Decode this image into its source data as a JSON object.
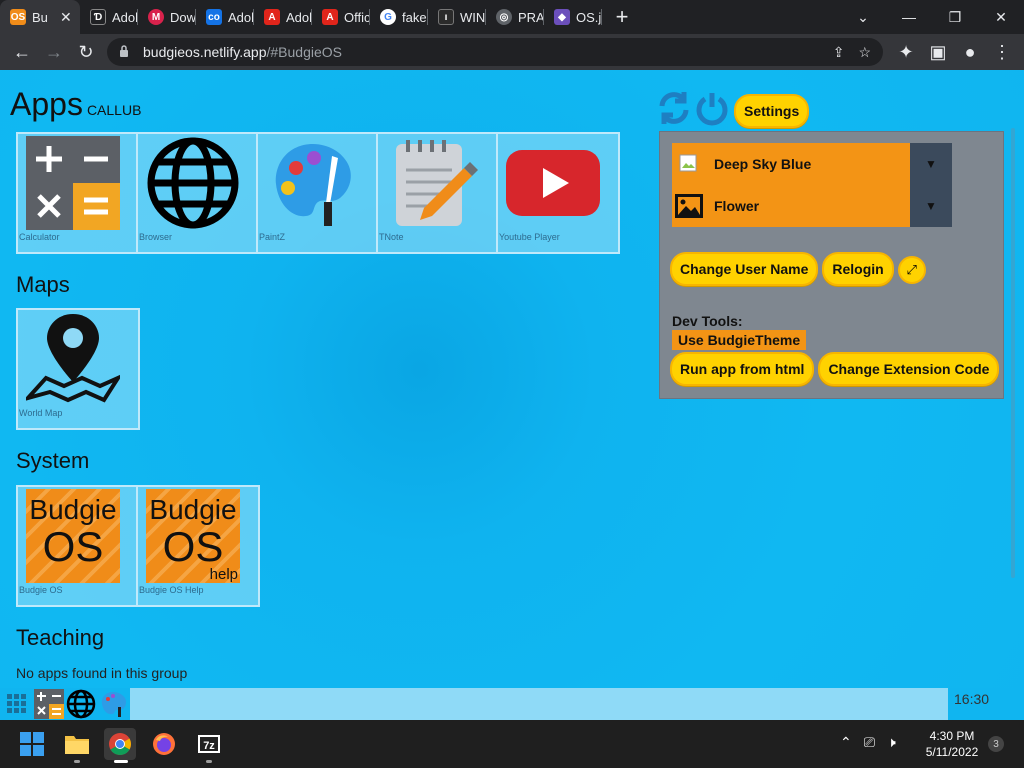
{
  "browser": {
    "tabs": [
      {
        "title": "Bu",
        "favicon_text": "OS",
        "favicon_color": "#f08c19",
        "active": true
      },
      {
        "title": "Adobe",
        "favicon_text": "Ɗ",
        "favicon_color": "#202124"
      },
      {
        "title": "Downl",
        "favicon_text": "M",
        "favicon_color": "#d9224c"
      },
      {
        "title": "Adobe",
        "favicon_text": "co",
        "favicon_color": "#1473e6"
      },
      {
        "title": "Adobe",
        "favicon_text": "A",
        "favicon_color": "#e1251b"
      },
      {
        "title": "Officia",
        "favicon_text": "A",
        "favicon_color": "#e1251b"
      },
      {
        "title": "fake o",
        "favicon_text": "G",
        "favicon_color": "#4285f4"
      },
      {
        "title": "WIND",
        "favicon_text": "ı",
        "favicon_color": "#2b2b2b"
      },
      {
        "title": "PRAN",
        "favicon_text": "◎",
        "favicon_color": "#5f6368"
      },
      {
        "title": "OS.js (",
        "favicon_text": "◆",
        "favicon_color": "#6b4fbb"
      }
    ],
    "new_tab": "+",
    "url_host": "budgieos.netlify.app",
    "url_path": "/#BudgieOS"
  },
  "os": {
    "apps_title": "Apps",
    "username": "CALLUB",
    "groups": {
      "apps": [
        {
          "label": "Calculator",
          "icon": "calculator-icon"
        },
        {
          "label": "Browser",
          "icon": "globe-icon"
        },
        {
          "label": "PaintZ",
          "icon": "palette-icon"
        },
        {
          "label": "TNote",
          "icon": "notepad-icon"
        },
        {
          "label": "Youtube Player",
          "icon": "youtube-icon"
        }
      ],
      "maps_title": "Maps",
      "maps": [
        {
          "label": "World Map",
          "icon": "map-pin-icon"
        }
      ],
      "system_title": "System",
      "system": [
        {
          "label": "Budgie OS",
          "icon": "budgie-os-icon",
          "line1": "Budgie",
          "line2": "OS"
        },
        {
          "label": "Budgie OS Help",
          "icon": "budgie-help-icon",
          "line1": "Budgie",
          "line2": "OS",
          "line3": "help"
        }
      ],
      "teaching_title": "Teaching",
      "teaching_empty": "No apps found in this group"
    },
    "settings": {
      "button": "Settings",
      "color_select": "Deep Sky Blue",
      "wallpaper_select": "Flower",
      "change_user": "Change User Name",
      "relogin": "Relogin",
      "dev_tools": "Dev Tools:",
      "use_theme": "Use BudgieTheme",
      "run_app": "Run app from html",
      "change_ext": "Change Extension Code"
    },
    "clock": "16:30"
  },
  "windows": {
    "time": "4:30 PM",
    "date": "5/11/2022",
    "notification_count": "3"
  },
  "colors": {
    "desktop_bg": "#10b5f0",
    "pill_yellow": "#ffd200",
    "accent_orange": "#f39415",
    "panel_gray": "#7f8790"
  }
}
